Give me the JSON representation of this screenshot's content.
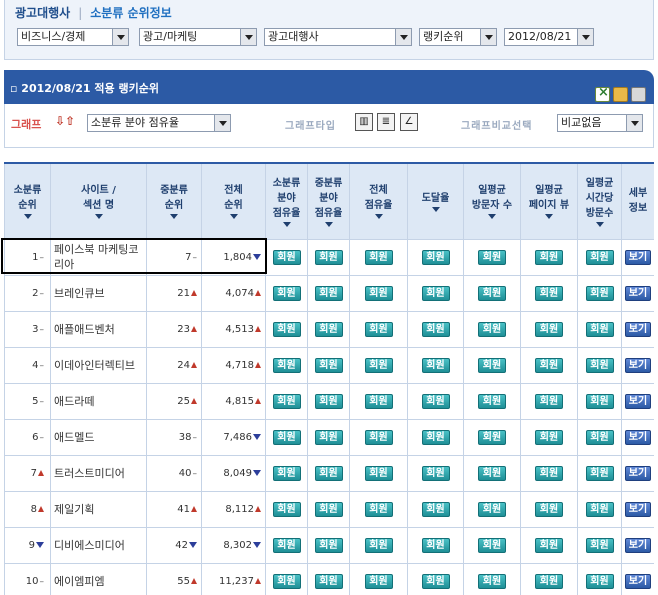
{
  "header": {
    "title": "광고대행사",
    "separator": "|",
    "subtitle": "소분류 순위정보"
  },
  "filters": [
    {
      "value": "비즈니스/경제"
    },
    {
      "value": "광고/마케팅"
    },
    {
      "value": "광고대행사"
    },
    {
      "value": "랭키순위"
    },
    {
      "value": "2012/08/21"
    }
  ],
  "section": {
    "title": "2012/08/21 적용 랭키순위"
  },
  "options": {
    "graph_label": "그래프",
    "graph_select": "소분류 분야 점유율",
    "graph_type_label": "그래프타입",
    "compare_label": "그래프비교선택",
    "compare_select": "비교없음",
    "chart_icons": [
      "bar-chart-icon",
      "list-chart-icon",
      "line-chart-icon"
    ]
  },
  "colors": {
    "accent": "#2c5aa5",
    "member_button": "#1f8f96",
    "view_button": "#2c5aa5",
    "up": "#c0392b",
    "down": "#2c3e9a"
  },
  "table": {
    "columns": [
      [
        "소분류",
        "순위"
      ],
      [
        "사이트 /",
        "섹션 명"
      ],
      [
        "중분류",
        "순위"
      ],
      [
        "전체",
        "순위"
      ],
      [
        "소분류",
        "분야",
        "점유율"
      ],
      [
        "중분류",
        "분야",
        "점유율"
      ],
      [
        "전체",
        "점유율"
      ],
      [
        "도달율"
      ],
      [
        "일평균",
        "방문자 수"
      ],
      [
        "일평균",
        "페이지 뷰"
      ],
      [
        "일평균",
        "시간당",
        "방문수"
      ],
      [
        "세부",
        "정보"
      ]
    ],
    "member_label": "회원",
    "view_label": "보기",
    "rows": [
      {
        "rank": "1",
        "rank_change": "same",
        "name": "페이스북 마케팅코리아",
        "mid_rank": "7",
        "mid_change": "same",
        "total_rank": "1,804",
        "total_change": "down"
      },
      {
        "rank": "2",
        "rank_change": "same",
        "name": "브레인큐브",
        "mid_rank": "21",
        "mid_change": "up",
        "total_rank": "4,074",
        "total_change": "up"
      },
      {
        "rank": "3",
        "rank_change": "same",
        "name": "애플애드벤처",
        "mid_rank": "23",
        "mid_change": "up",
        "total_rank": "4,513",
        "total_change": "up"
      },
      {
        "rank": "4",
        "rank_change": "same",
        "name": "이데아인터렉티브",
        "mid_rank": "24",
        "mid_change": "up",
        "total_rank": "4,718",
        "total_change": "up"
      },
      {
        "rank": "5",
        "rank_change": "same",
        "name": "애드라떼",
        "mid_rank": "25",
        "mid_change": "up",
        "total_rank": "4,815",
        "total_change": "up"
      },
      {
        "rank": "6",
        "rank_change": "same",
        "name": "애드멜드",
        "mid_rank": "38",
        "mid_change": "same",
        "total_rank": "7,486",
        "total_change": "down"
      },
      {
        "rank": "7",
        "rank_change": "up",
        "name": "트러스트미디어",
        "mid_rank": "40",
        "mid_change": "same",
        "total_rank": "8,049",
        "total_change": "down"
      },
      {
        "rank": "8",
        "rank_change": "up",
        "name": "제일기획",
        "mid_rank": "41",
        "mid_change": "up",
        "total_rank": "8,112",
        "total_change": "up"
      },
      {
        "rank": "9",
        "rank_change": "down",
        "name": "디비에스미디어",
        "mid_rank": "42",
        "mid_change": "down",
        "total_rank": "8,302",
        "total_change": "down"
      },
      {
        "rank": "10",
        "rank_change": "same",
        "name": "에이엠피엠",
        "mid_rank": "55",
        "mid_change": "up",
        "total_rank": "11,237",
        "total_change": "up"
      }
    ]
  }
}
